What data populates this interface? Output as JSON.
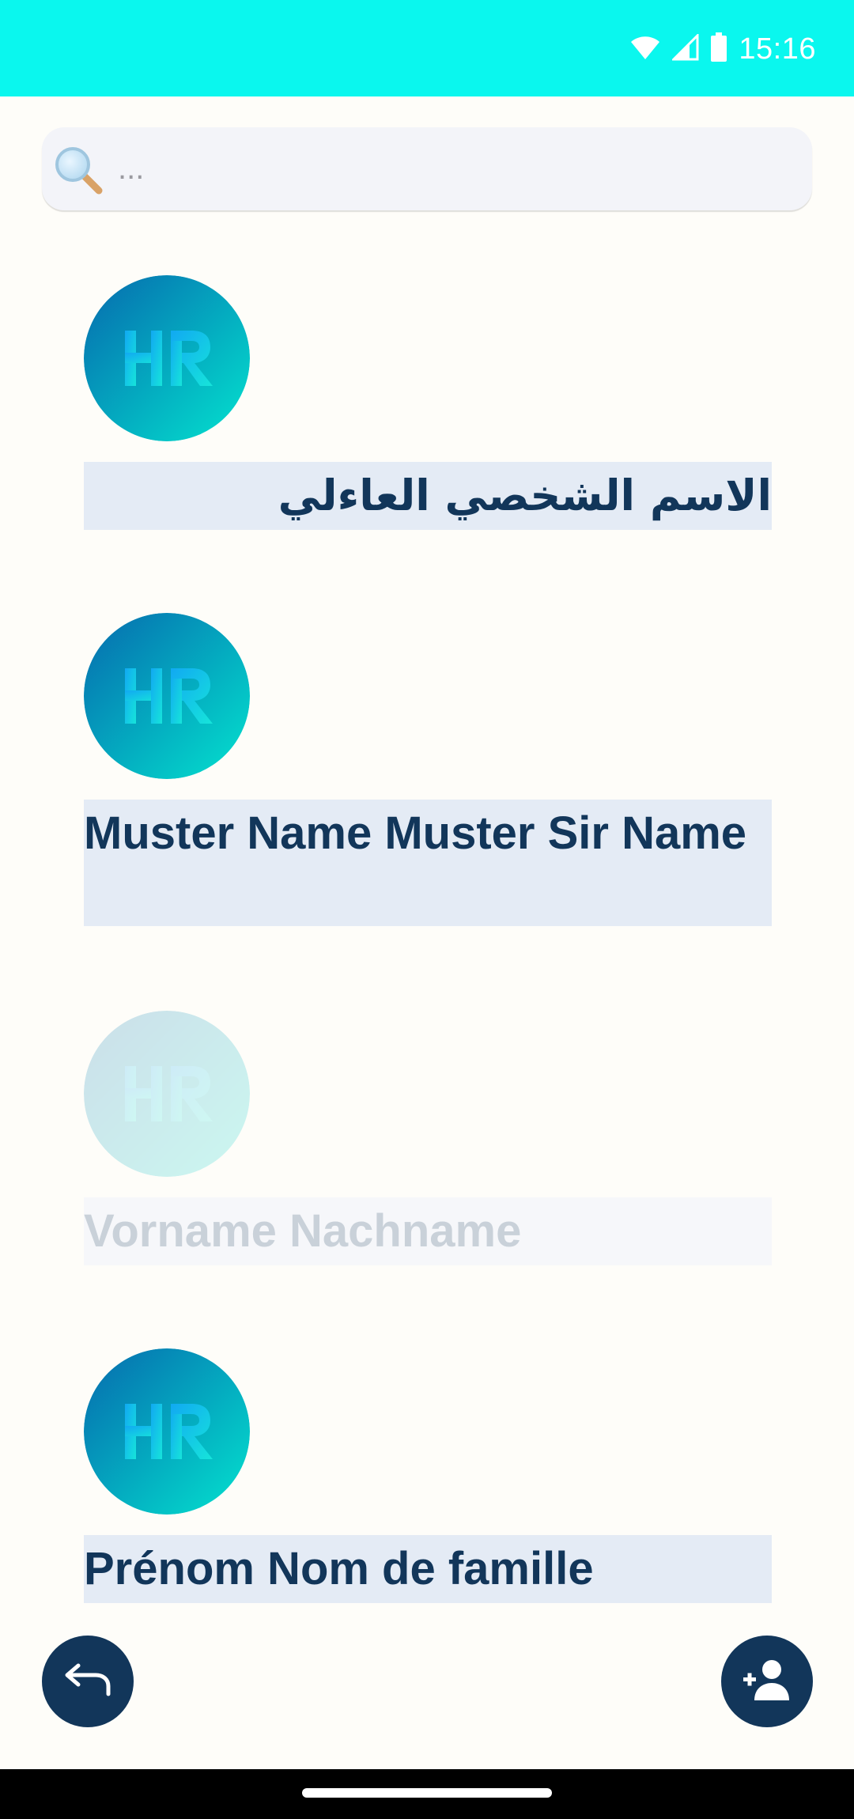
{
  "status_bar": {
    "time": "15:16",
    "background": "#0af7ee",
    "icons": [
      "wifi-icon",
      "cellular-signal-icon",
      "battery-icon"
    ]
  },
  "search": {
    "placeholder": "...",
    "value": "",
    "icon": "magnifier-icon"
  },
  "contacts": [
    {
      "name": "الاسم الشخصي العاءلي",
      "avatar": "hr-logo",
      "direction": "rtl",
      "dimmed": false
    },
    {
      "name": "Muster Name  Muster Sir Name",
      "avatar": "hr-logo",
      "direction": "ltr",
      "dimmed": false
    },
    {
      "name": "Vorname  Nachname",
      "avatar": "hr-logo",
      "direction": "ltr",
      "dimmed": true
    },
    {
      "name": "Prénom  Nom de famille",
      "avatar": "hr-logo",
      "direction": "ltr",
      "dimmed": false
    }
  ],
  "actions": {
    "back_icon": "undo-arrow-icon",
    "add_icon": "add-person-icon"
  },
  "colors": {
    "accent": "#0af7ee",
    "primary": "#12365a",
    "name_background": "#e4ebf5",
    "page_background": "#fefdf9"
  }
}
